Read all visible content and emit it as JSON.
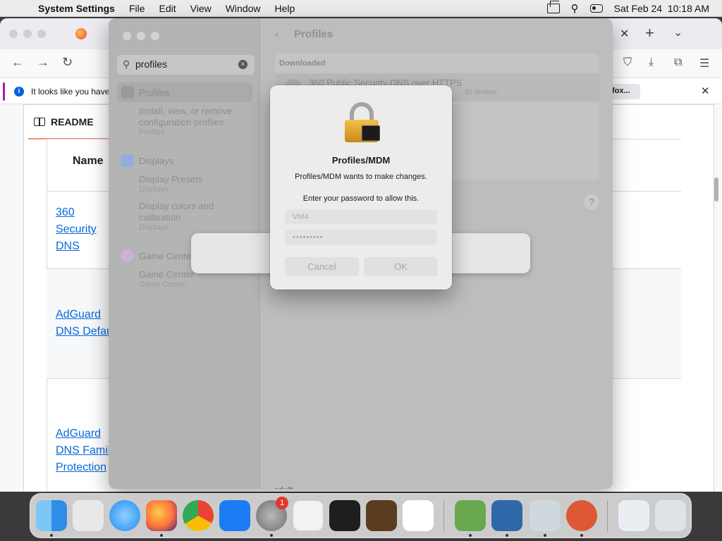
{
  "menubar": {
    "app_name": "System Settings",
    "menus": [
      "File",
      "Edit",
      "View",
      "Window",
      "Help"
    ],
    "datetime": "Sat Feb 24  10:18 AM"
  },
  "firefox": {
    "notice_text": "It looks like you haven",
    "notice_button": "fox...",
    "readme_label": "README",
    "table_header": "Name",
    "rows": [
      {
        "lines": [
          "360",
          "Security",
          "DNS"
        ]
      },
      {
        "lines": [
          "AdGuard",
          "DNS Defau"
        ]
      },
      {
        "lines": [
          "AdGuard",
          "DNS Famil",
          "Protection"
        ]
      }
    ]
  },
  "settings": {
    "search_value": "profiles",
    "header": "Profiles",
    "sidebar": [
      {
        "title": "Profiles",
        "sub": [
          "Install, view, or remove",
          "configuration profiles"
        ],
        "cat": "Profiles"
      },
      {
        "title": "Displays",
        "entries": [
          {
            "sub": [
              "Display Presets"
            ],
            "cat": "Displays"
          },
          {
            "sub": [
              "Display colors and",
              "calibration"
            ],
            "cat": "Displays"
          }
        ]
      },
      {
        "title": "Game Center",
        "sub": [
          "Game Center"
        ],
        "cat": "Game Center"
      }
    ],
    "downloaded_label": "Downloaded",
    "downloaded_item": "360 Public Security DNS over HTTPS",
    "downloaded_sub": "to review.",
    "help": "?",
    "bottom_text": "adult"
  },
  "dialog": {
    "title": "Profiles/MDM",
    "message": "Profiles/MDM wants to make changes.",
    "prompt": "Enter your password to allow this.",
    "username": "VM4",
    "password_mask": "•••••••••",
    "cancel_label": "Cancel",
    "ok_label": "OK"
  },
  "dock": {
    "apps": [
      "Finder",
      "Launchpad",
      "Safari",
      "Firefox",
      "Chrome",
      "App Store",
      "System Settings",
      "TextEdit",
      "Terminal",
      "GarageBand",
      "Visual Studio Code",
      "Minecraft",
      "VirtualBox",
      "Installer",
      "DuckDuckGo",
      "Preview",
      "Trash"
    ],
    "settings_badge": "1",
    "colors": {
      "finder": "#2f8ce8",
      "launchpad": "#e8e8e8",
      "safari": "#1f8bf0",
      "firefox": "#ff7139",
      "chrome": "#34a853",
      "appstore": "#1c7cf4",
      "settings": "#8a8a8a",
      "textedit": "#f2f2f2",
      "terminal": "#1e1e1e",
      "garageband": "#5a3d1e",
      "vscode": "#ffffff",
      "minecraft": "#6aa84f",
      "virtualbox": "#2f67a8",
      "installer": "#cfd8dc",
      "duckduckgo": "#de5833",
      "preview": "#e9eef3",
      "trash": "#dfe3e6"
    }
  }
}
